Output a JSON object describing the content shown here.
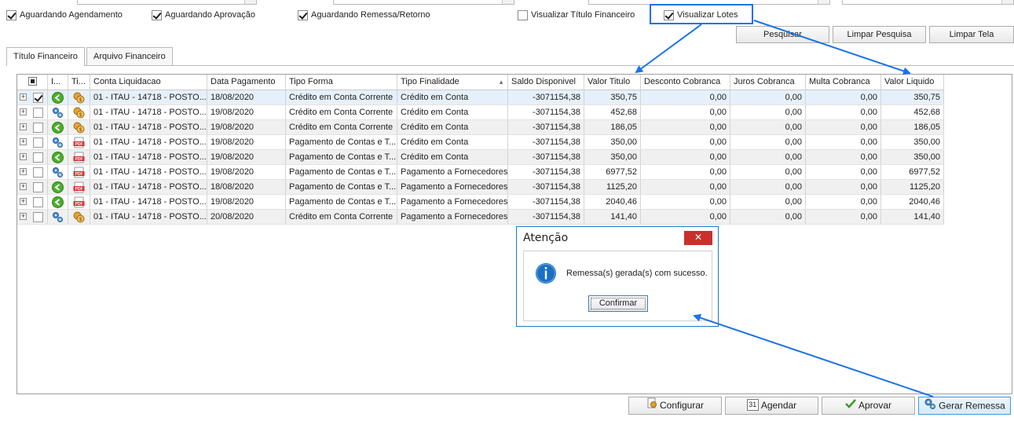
{
  "filters": {
    "aguardando_agendamento": {
      "label": "Aguardando Agendamento",
      "checked": true
    },
    "aguardando_aprovacao": {
      "label": "Aguardando Aprovação",
      "checked": true
    },
    "aguardando_remessa": {
      "label": "Aguardando Remessa/Retorno",
      "checked": true
    },
    "visualizar_titulo": {
      "label": "Visualizar Título Financeiro",
      "checked": false
    },
    "visualizar_lotes": {
      "label": "Visualizar Lotes",
      "checked": true
    }
  },
  "toolbar": {
    "pesquisar": "Pesquisar",
    "limpar_pesquisa": "Limpar Pesquisa",
    "limpar_tela": "Limpar Tela"
  },
  "tabs": [
    {
      "label": "Título Financeiro",
      "active": true
    },
    {
      "label": "Arquivo Financeiro",
      "active": false
    }
  ],
  "grid": {
    "columns": [
      "I...",
      "Ti...",
      "Conta Liquidacao",
      "Data Pagamento",
      "Tipo Forma",
      "Tipo Finalidade",
      "Saldo Disponivel",
      "Valor Titulo",
      "Desconto Cobranca",
      "Juros Cobranca",
      "Multa Cobranca",
      "Valor Liquido"
    ],
    "sort_indicator": "▲",
    "rows": [
      {
        "checked": true,
        "status_icon": "green-arrow-icon",
        "type_icon": "coins-icon",
        "conta": "01 - ITAU - 14718 - POSTO...",
        "data": "18/08/2020",
        "forma": "Crédito em Conta Corrente",
        "finalidade": "Crédito em Conta",
        "saldo": "-3071154,38",
        "valor": "350,75",
        "desconto": "0,00",
        "juros": "0,00",
        "multa": "0,00",
        "liquido": "350,75"
      },
      {
        "checked": false,
        "status_icon": "gears-icon",
        "type_icon": "coins-icon",
        "conta": "01 - ITAU - 14718 - POSTO...",
        "data": "19/08/2020",
        "forma": "Crédito em Conta Corrente",
        "finalidade": "Crédito em Conta",
        "saldo": "-3071154,38",
        "valor": "452,68",
        "desconto": "0,00",
        "juros": "0,00",
        "multa": "0,00",
        "liquido": "452,68"
      },
      {
        "checked": false,
        "status_icon": "green-arrow-icon",
        "type_icon": "coins-icon",
        "conta": "01 - ITAU - 14718 - POSTO...",
        "data": "19/08/2020",
        "forma": "Crédito em Conta Corrente",
        "finalidade": "Crédito em Conta",
        "saldo": "-3071154,38",
        "valor": "186,05",
        "desconto": "0,00",
        "juros": "0,00",
        "multa": "0,00",
        "liquido": "186,05"
      },
      {
        "checked": false,
        "status_icon": "gears-icon",
        "type_icon": "pdf-icon",
        "conta": "01 - ITAU - 14718 - POSTO...",
        "data": "19/08/2020",
        "forma": "Pagamento de Contas e T...",
        "finalidade": "Crédito em Conta",
        "saldo": "-3071154,38",
        "valor": "350,00",
        "desconto": "0,00",
        "juros": "0,00",
        "multa": "0,00",
        "liquido": "350,00"
      },
      {
        "checked": false,
        "status_icon": "green-arrow-icon",
        "type_icon": "pdf-icon",
        "conta": "01 - ITAU - 14718 - POSTO...",
        "data": "19/08/2020",
        "forma": "Pagamento de Contas e T...",
        "finalidade": "Crédito em Conta",
        "saldo": "-3071154,38",
        "valor": "350,00",
        "desconto": "0,00",
        "juros": "0,00",
        "multa": "0,00",
        "liquido": "350,00"
      },
      {
        "checked": false,
        "status_icon": "gears-icon",
        "type_icon": "pdf-icon",
        "conta": "01 - ITAU - 14718 - POSTO...",
        "data": "19/08/2020",
        "forma": "Pagamento de Contas e T...",
        "finalidade": "Pagamento a Fornecedores",
        "saldo": "-3071154,38",
        "valor": "6977,52",
        "desconto": "0,00",
        "juros": "0,00",
        "multa": "0,00",
        "liquido": "6977,52"
      },
      {
        "checked": false,
        "status_icon": "green-arrow-icon",
        "type_icon": "pdf-icon",
        "conta": "01 - ITAU - 14718 - POSTO...",
        "data": "18/08/2020",
        "forma": "Pagamento de Contas e T...",
        "finalidade": "Pagamento a Fornecedores",
        "saldo": "-3071154,38",
        "valor": "1125,20",
        "desconto": "0,00",
        "juros": "0,00",
        "multa": "0,00",
        "liquido": "1125,20"
      },
      {
        "checked": false,
        "status_icon": "green-arrow-icon",
        "type_icon": "pdf-icon",
        "conta": "01 - ITAU - 14718 - POSTO...",
        "data": "19/08/2020",
        "forma": "Pagamento de Contas e T...",
        "finalidade": "Pagamento a Fornecedores",
        "saldo": "-3071154,38",
        "valor": "2040,46",
        "desconto": "0,00",
        "juros": "0,00",
        "multa": "0,00",
        "liquido": "2040,46"
      },
      {
        "checked": false,
        "status_icon": "gears-icon",
        "type_icon": "coins-icon",
        "conta": "01 - ITAU - 14718 - POSTO...",
        "data": "20/08/2020",
        "forma": "Crédito em Conta Corrente",
        "finalidade": "Pagamento a Fornecedores",
        "saldo": "-3071154,38",
        "valor": "141,40",
        "desconto": "0,00",
        "juros": "0,00",
        "multa": "0,00",
        "liquido": "141,40"
      }
    ]
  },
  "dialog": {
    "title": "Atenção",
    "message": "Remessa(s) gerada(s) com sucesso.",
    "confirm": "Confirmar",
    "close": "✕"
  },
  "bottom": {
    "configurar": "Configurar",
    "agendar": "Agendar",
    "calendar_day": "31",
    "aprovar": "Aprovar",
    "gerar_remessa": "Gerar Remessa"
  },
  "colors": {
    "annotation": "#1a73e8",
    "selected_row": "#e6f0fb",
    "alt_row": "#f0f0f0"
  }
}
